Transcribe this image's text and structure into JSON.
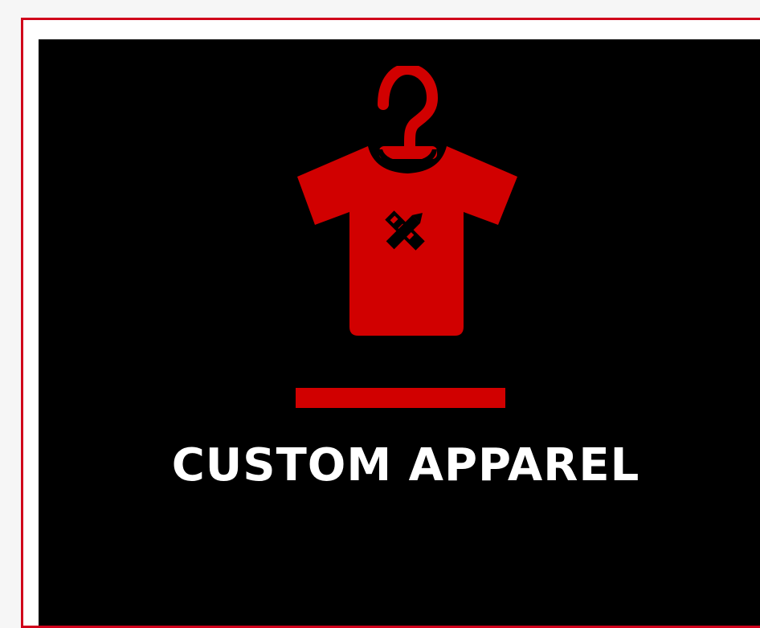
{
  "tile": {
    "title": "CUSTOM APPAREL",
    "icon": "tshirt-hanger-icon",
    "accent_color": "#d10000",
    "background_color": "#000000",
    "text_color": "#ffffff"
  }
}
